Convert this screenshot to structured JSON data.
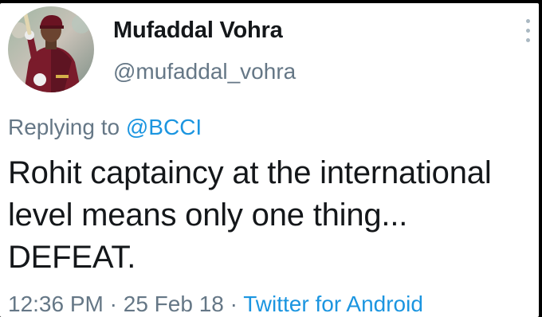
{
  "author": {
    "display_name": "Mufaddal Vohra",
    "handle": "@mufaddal_vohra",
    "avatar_icon": "profile-avatar-cricketer"
  },
  "menu_icon": "more-vertical-icon",
  "reply": {
    "prefix": "Replying to",
    "mention": "@BCCI"
  },
  "tweet": {
    "text": "Rohit captaincy at the international level means only one thing... DEFEAT."
  },
  "meta": {
    "time": "12:36 PM",
    "sep1": " · ",
    "date": "25 Feb 18",
    "sep2": " · ",
    "source": "Twitter for Android"
  },
  "colors": {
    "text": "#14171a",
    "secondary": "#657786",
    "link": "#1b95e0",
    "background": "#ffffff"
  }
}
